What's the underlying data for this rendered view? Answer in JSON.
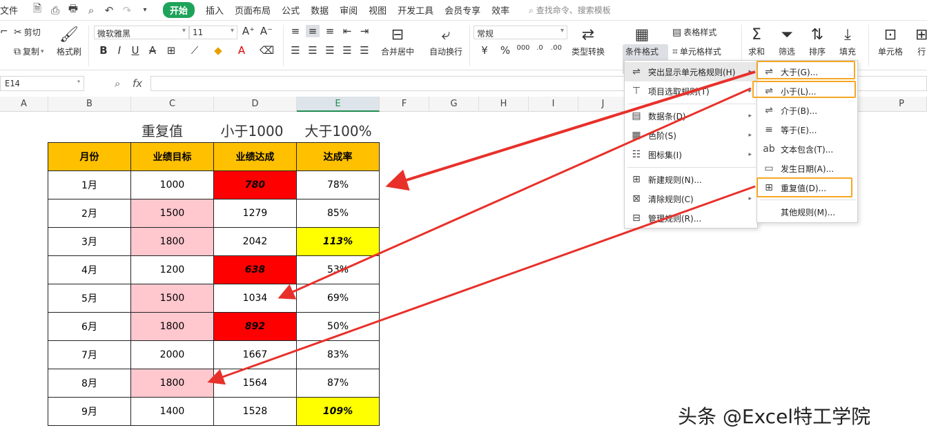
{
  "menubar": {
    "file": "文件",
    "tabs": [
      "开始",
      "插入",
      "页面布局",
      "公式",
      "数据",
      "审阅",
      "视图",
      "开发工具",
      "会员专享",
      "效率"
    ],
    "search": "查找命令、搜索模板"
  },
  "ribbon": {
    "cut": "剪切",
    "copy": "复制",
    "format_painter": "格式刷",
    "font_name": "微软雅黑",
    "font_size": "11",
    "number_format": "常规",
    "merge_center": "合并居中",
    "wrap_text": "自动换行",
    "currency": "¥",
    "percent": "%",
    "type_convert": "类型转换",
    "conditional_format": "条件格式",
    "table_style": "表格样式",
    "cell_style": "单元格样式",
    "sum": "求和",
    "filter": "筛选",
    "sort": "排序",
    "fill": "填充",
    "cell": "单元格",
    "row_col": "行"
  },
  "formula_bar": {
    "name_box": "E14",
    "fx": "fx"
  },
  "columns": [
    "A",
    "B",
    "C",
    "D",
    "E",
    "F",
    "G",
    "H",
    "I",
    "J",
    "P"
  ],
  "sheet": {
    "titles": {
      "dup": "重复值",
      "lt": "小于1000",
      "gt": "大于100%"
    },
    "headers": [
      "月份",
      "业绩目标",
      "业绩达成",
      "达成率"
    ],
    "rows": [
      [
        "1月",
        "1000",
        "780",
        "78%"
      ],
      [
        "2月",
        "1500",
        "1279",
        "85%"
      ],
      [
        "3月",
        "1800",
        "2042",
        "113%"
      ],
      [
        "4月",
        "1200",
        "638",
        "53%"
      ],
      [
        "5月",
        "1500",
        "1034",
        "69%"
      ],
      [
        "6月",
        "1800",
        "892",
        "50%"
      ],
      [
        "7月",
        "2000",
        "1667",
        "83%"
      ],
      [
        "8月",
        "1800",
        "1564",
        "87%"
      ],
      [
        "9月",
        "1400",
        "1528",
        "109%"
      ]
    ]
  },
  "menu1": {
    "items": [
      "突出显示单元格规则(H)",
      "项目选取规则(T)",
      "数据条(D)",
      "色阶(S)",
      "图标集(I)",
      "新建规则(N)...",
      "清除规则(C)",
      "管理规则(R)..."
    ]
  },
  "menu2": {
    "items": [
      "大于(G)...",
      "小于(L)...",
      "介于(B)...",
      "等于(E)...",
      "文本包含(T)...",
      "发生日期(A)...",
      "重复值(D)...",
      "其他规则(M)..."
    ]
  },
  "watermark": "头条 @Excel特工学院",
  "colors": {
    "accent": "#1ea35a",
    "header_fill": "#ffc000",
    "pink": "#ffc7ce",
    "red": "#ff0000",
    "yellow": "#ffff00",
    "highlight_box": "#f5a623",
    "arrow": "#e8302a"
  }
}
